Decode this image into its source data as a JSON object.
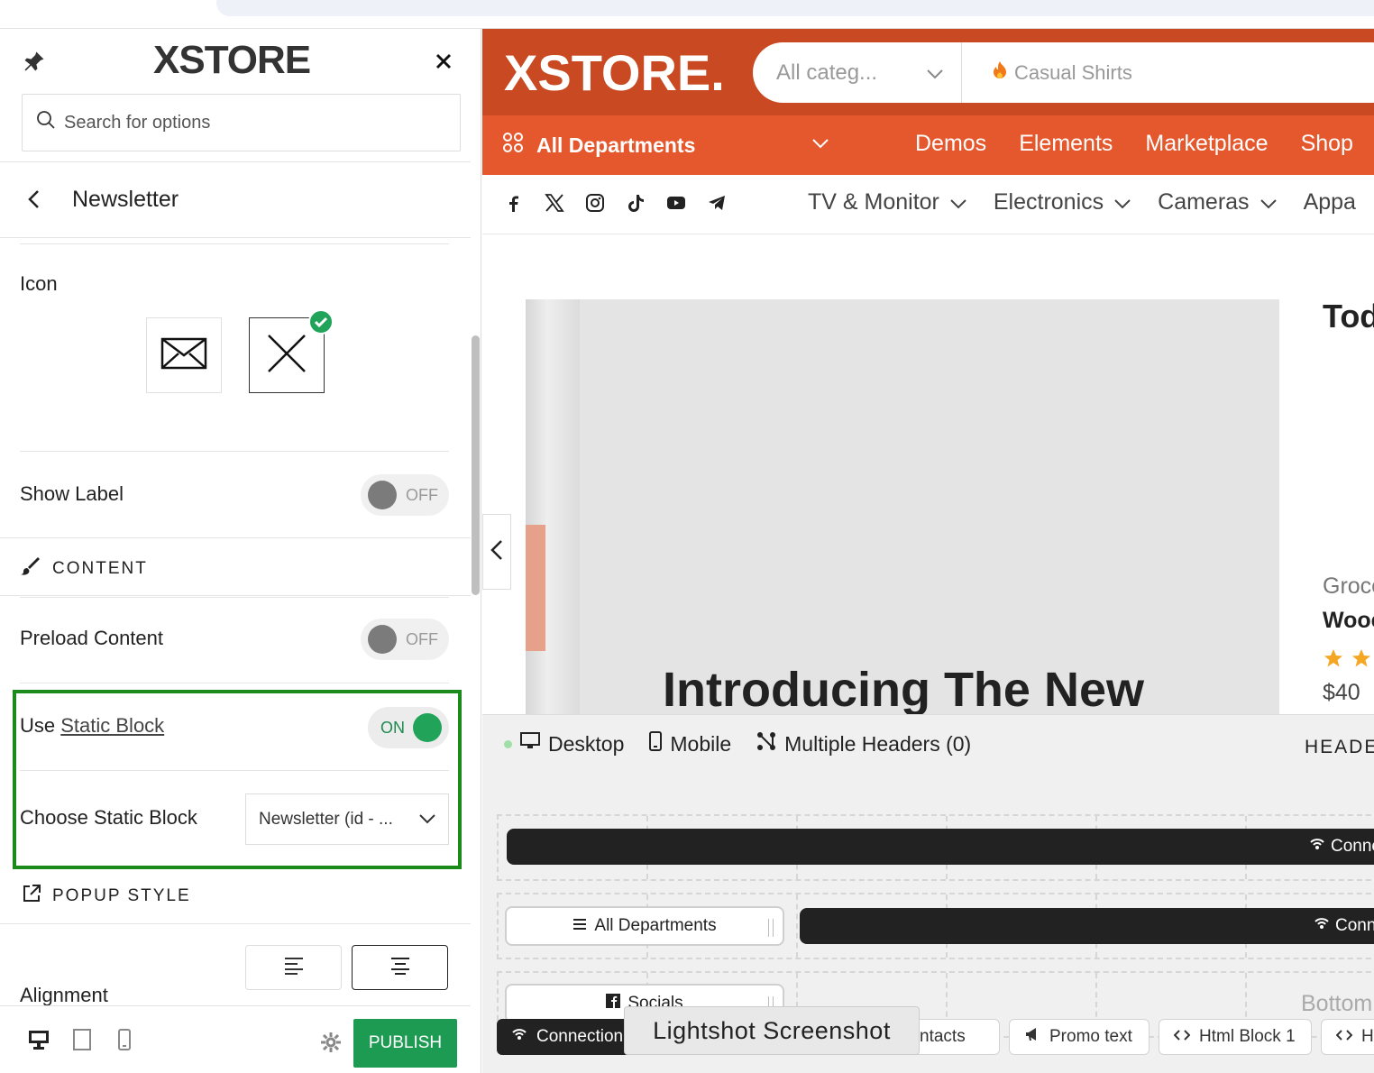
{
  "panel": {
    "brand": "XSTORE",
    "search_placeholder": "Search for options",
    "section_title": "Newsletter",
    "icon_label": "Icon",
    "show_label": {
      "label": "Show Label",
      "state": "OFF"
    },
    "content_head": "CONTENT",
    "preload_content": {
      "label": "Preload Content",
      "state": "OFF"
    },
    "use_static_block": {
      "prefix": "Use ",
      "link": "Static Block",
      "state": "ON"
    },
    "choose_static_block": {
      "label": "Choose Static Block",
      "value": "Newsletter (id - ..."
    },
    "popup_style_head": "POPUP STYLE",
    "alignment_label": "Alignment",
    "publish_label": "PUBLISH"
  },
  "preview": {
    "logo": "XSTORE.",
    "category_select": "All categ...",
    "search_suggestion": "Casual Shirts",
    "departments": "All Departments",
    "nav_links": [
      "Demos",
      "Elements",
      "Marketplace",
      "Shop"
    ],
    "category_links": [
      "TV & Monitor",
      "Electronics",
      "Cameras",
      "Appa"
    ],
    "hero_headline": "Introducing The New",
    "right_title": "Tod",
    "right_cat": "Groce",
    "right_name": "Wooc",
    "right_price": "$40"
  },
  "builder": {
    "tabs": [
      "Desktop",
      "Mobile",
      "Multiple Headers (0)"
    ],
    "head_label": "HEADE",
    "row1_bar": "Conne",
    "row2_chip": "All Departments",
    "row2_bar": "Conne",
    "row3_chip": "Socials",
    "row3_right": "Bottom",
    "bottom_tabs": [
      "Connection",
      "ntacts",
      "Promo text",
      "Html Block 1",
      "Htn"
    ],
    "tooltip": "Lightshot Screenshot"
  },
  "colors": {
    "brand_dark": "#c94a22",
    "brand_orange": "#e5582d",
    "publish_green": "#1e9b52",
    "highlight_green": "#1a8a1a"
  }
}
